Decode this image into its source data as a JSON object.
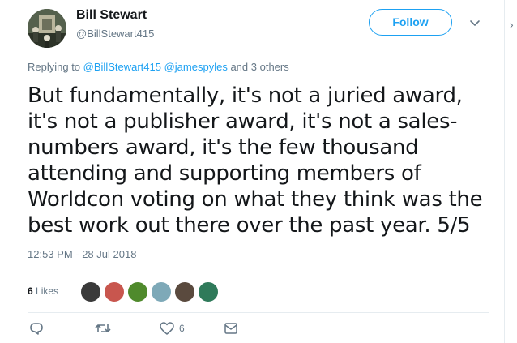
{
  "author": {
    "name": "Bill Stewart",
    "handle": "@BillStewart415",
    "avatar_icon": "avatar-photo"
  },
  "follow_label": "Follow",
  "reply_line": {
    "prefix": "Replying to",
    "mention1": "@BillStewart415",
    "mention2": "@jamespyles",
    "suffix": "and 3 others"
  },
  "tweet_text": "But fundamentally, it's not a juried award, it's not a publisher award, it's not a sales-numbers award, it's the few thousand attending and supporting members of Worldcon voting on what they think was the best work out there over the past year. 5/5",
  "timestamp": "12:53 PM - 28 Jul 2018",
  "likes": {
    "count": "6",
    "label": "Likes"
  },
  "likers": [
    {
      "icon": "liker-avatar-1",
      "color": "#3a3a3a"
    },
    {
      "icon": "liker-avatar-2",
      "color": "#c8564e"
    },
    {
      "icon": "liker-avatar-3",
      "color": "#4f8a2c"
    },
    {
      "icon": "liker-avatar-4",
      "color": "#7ea9b8"
    },
    {
      "icon": "liker-avatar-5",
      "color": "#5a4a3e"
    },
    {
      "icon": "liker-avatar-6",
      "color": "#2f7a5a"
    }
  ],
  "actions": {
    "reply_icon": "reply-icon",
    "retweet_icon": "retweet-icon",
    "like_icon": "heart-icon",
    "like_count": "6",
    "dm_icon": "envelope-icon"
  },
  "accent_color": "#1da1f2"
}
